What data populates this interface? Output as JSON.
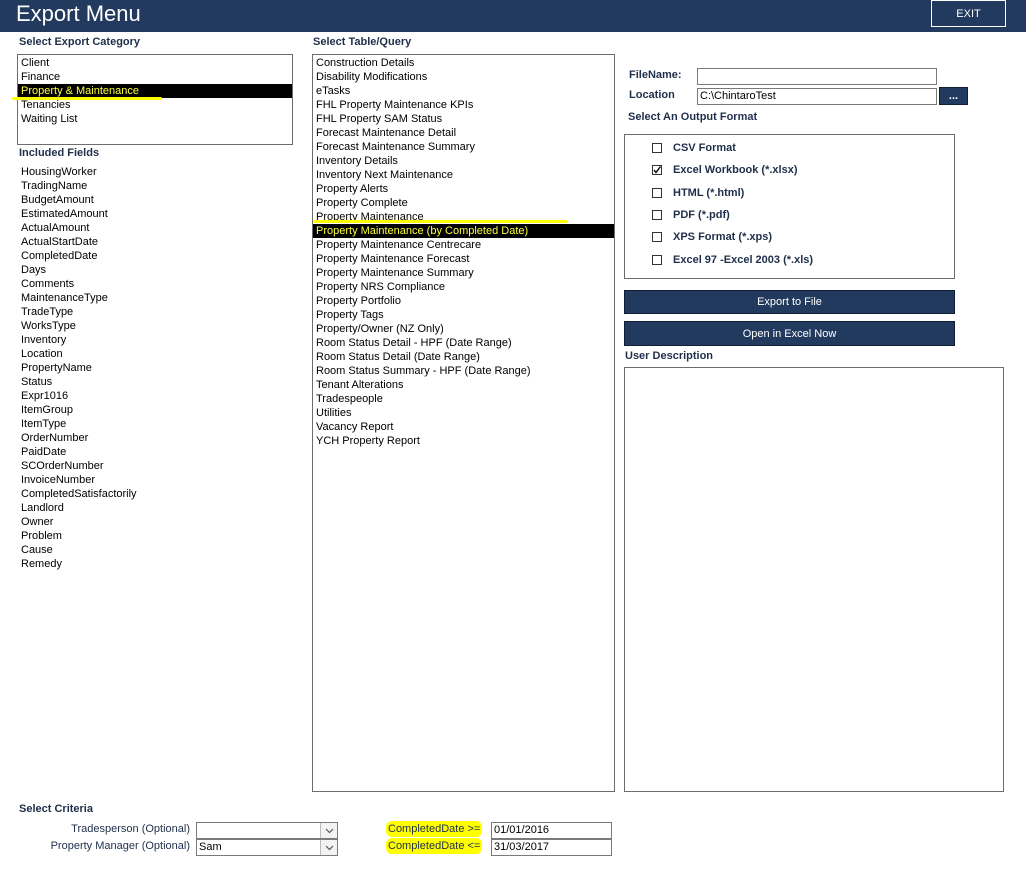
{
  "window": {
    "title": "Export Menu",
    "exit_label": "EXIT"
  },
  "export_category": {
    "label": "Select Export Category",
    "items": [
      "Client",
      "Finance",
      "Property & Maintenance",
      "Tenancies",
      "Waiting List"
    ],
    "selected": "Property & Maintenance"
  },
  "included_fields": {
    "label": "Included Fields",
    "items": [
      "HousingWorker",
      "TradingName",
      "BudgetAmount",
      "EstimatedAmount",
      "ActualAmount",
      "ActualStartDate",
      "CompletedDate",
      "Days",
      "Comments",
      "MaintenanceType",
      "TradeType",
      "WorksType",
      "Inventory",
      "Location",
      "PropertyName",
      "Status",
      "Expr1016",
      "ItemGroup",
      "ItemType",
      "OrderNumber",
      "PaidDate",
      "SCOrderNumber",
      "InvoiceNumber",
      "CompletedSatisfactorily",
      "Landlord",
      "Owner",
      "Problem",
      "Cause",
      "Remedy"
    ]
  },
  "table_query": {
    "label": "Select Table/Query",
    "items": [
      "Construction Details",
      "Disability Modifications",
      "eTasks",
      "FHL Property Maintenance KPIs",
      "FHL Property SAM Status",
      "Forecast Maintenance Detail",
      "Forecast Maintenance Summary",
      "Inventory Details",
      "Inventory Next Maintenance",
      "Property Alerts",
      "Property Complete",
      "Property Maintenance",
      "Property Maintenance (by Completed Date)",
      "Property Maintenance Centrecare",
      "Property Maintenance Forecast",
      "Property Maintenance Summary",
      "Property NRS Compliance",
      "Property Portfolio",
      "Property Tags",
      "Property/Owner  (NZ Only)",
      "Room Status Detail - HPF (Date Range)",
      "Room Status Detail (Date Range)",
      "Room Status Summary - HPF (Date Range)",
      "Tenant Alterations",
      "Tradespeople",
      "Utilities",
      "Vacancy Report",
      "YCH Property Report"
    ],
    "selected": "Property Maintenance (by Completed Date)"
  },
  "file": {
    "filename_label": "FileName:",
    "filename_value": "",
    "location_label": "Location",
    "location_value": "C:\\ChintaroTest",
    "browse_label": "..."
  },
  "output_format": {
    "label": "Select An Output Format",
    "options": [
      {
        "label": "CSV Format",
        "checked": false
      },
      {
        "label": "Excel Workbook (*.xlsx)",
        "checked": true
      },
      {
        "label": "HTML (*.html)",
        "checked": false
      },
      {
        "label": "PDF (*.pdf)",
        "checked": false
      },
      {
        "label": "XPS Format (*.xps)",
        "checked": false
      },
      {
        "label": "Excel 97 -Excel 2003 (*.xls)",
        "checked": false
      }
    ]
  },
  "actions": {
    "export_label": "Export to File",
    "open_excel_label": "Open in Excel Now"
  },
  "user_description": {
    "label": "User Description",
    "value": ""
  },
  "criteria": {
    "label": "Select Criteria",
    "tradesperson_label": "Tradesperson (Optional)",
    "tradesperson_value": "",
    "property_manager_label": "Property Manager (Optional)",
    "property_manager_value": "Sam",
    "completed_from_label": "CompletedDate >=",
    "completed_from_value": "01/01/2016",
    "completed_to_label": "CompletedDate <=",
    "completed_to_value": "31/03/2017"
  },
  "colors": {
    "header_bg": "#223a5e",
    "highlight": "#ffff00",
    "selected_bg": "#000000",
    "selected_text": "#ffff3c"
  },
  "icons": {
    "dropdown": "chevron-down-icon",
    "checkmark": "check-icon"
  }
}
